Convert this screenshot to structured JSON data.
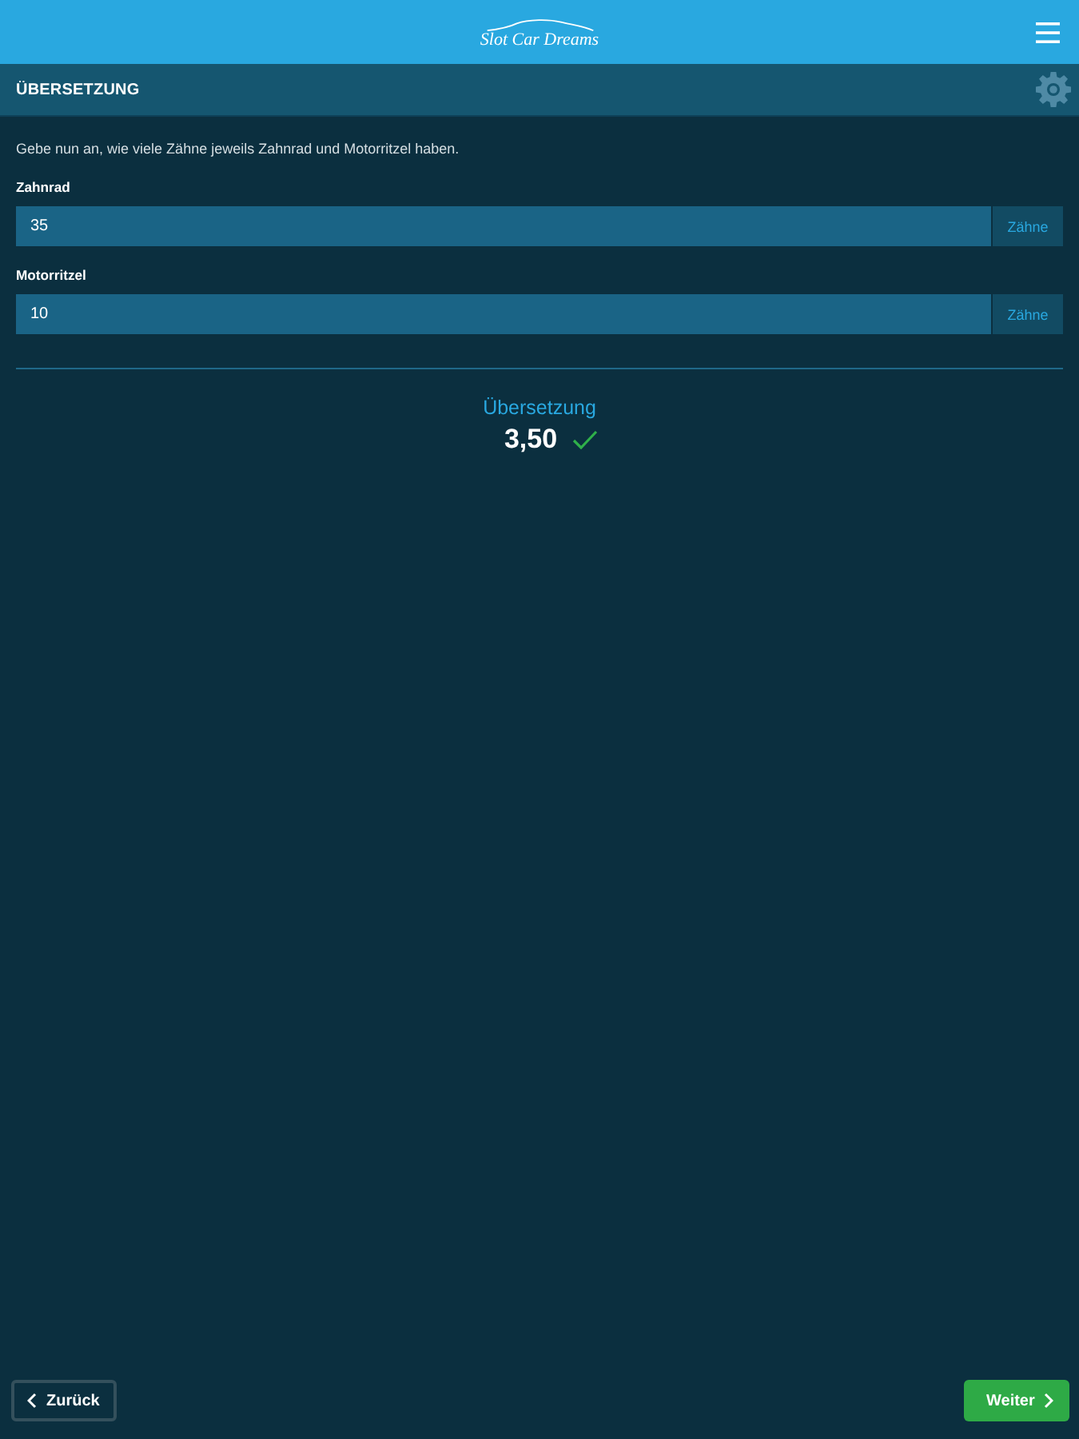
{
  "header": {
    "logo": "Slot Car Dreams"
  },
  "title_bar": {
    "title": "ÜBERSETZUNG"
  },
  "instruction": "Gebe nun an, wie viele Zähne jeweils Zahnrad und Motorritzel haben.",
  "fields": [
    {
      "label": "Zahnrad",
      "value": "35",
      "unit": "Zähne"
    },
    {
      "label": "Motorritzel",
      "value": "10",
      "unit": "Zähne"
    }
  ],
  "result": {
    "label": "Übersetzung",
    "value": "3,50",
    "valid": true
  },
  "buttons": [
    {
      "kind": "back",
      "label": "Zurück"
    },
    {
      "kind": "next",
      "label": "Weiter"
    }
  ]
}
